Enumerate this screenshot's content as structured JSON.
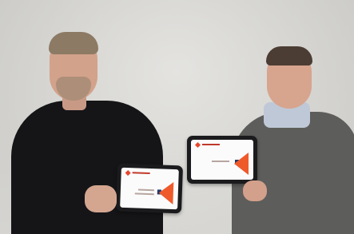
{
  "scene": {
    "people": [
      {
        "label": "person-left",
        "shirt_color": "#151518"
      },
      {
        "label": "person-right",
        "sweater_color": "#5d5d5b"
      }
    ],
    "tablets": [
      {
        "label": "tablet-left",
        "screen_accent": "#ef5a2b"
      },
      {
        "label": "tablet-right",
        "screen_accent": "#ef5a2b"
      }
    ],
    "background_color": "#dcdbd7"
  }
}
